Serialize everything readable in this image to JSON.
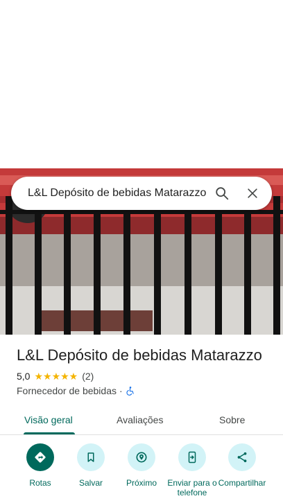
{
  "search": {
    "query": "L&L Depósito de bebidas Matarazzo"
  },
  "place": {
    "name": "L&L Depósito de bebidas Matarazzo",
    "rating": "5,0",
    "stars": "★★★★★",
    "review_count": "(2)",
    "category": "Fornecedor de bebidas",
    "separator": "·"
  },
  "tabs": [
    {
      "label": "Visão geral",
      "active": true
    },
    {
      "label": "Avaliações",
      "active": false
    },
    {
      "label": "Sobre",
      "active": false
    }
  ],
  "actions": [
    {
      "label": "Rotas",
      "icon": "directions-icon"
    },
    {
      "label": "Salvar",
      "icon": "bookmark-icon"
    },
    {
      "label": "Próximo",
      "icon": "nearby-icon"
    },
    {
      "label": "Enviar para o telefone",
      "icon": "send-to-phone-icon"
    },
    {
      "label": "Compartilhar",
      "icon": "share-icon"
    }
  ],
  "colors": {
    "accent": "#00695c",
    "action_bg": "#d2f3f7",
    "star": "#f4b400"
  }
}
